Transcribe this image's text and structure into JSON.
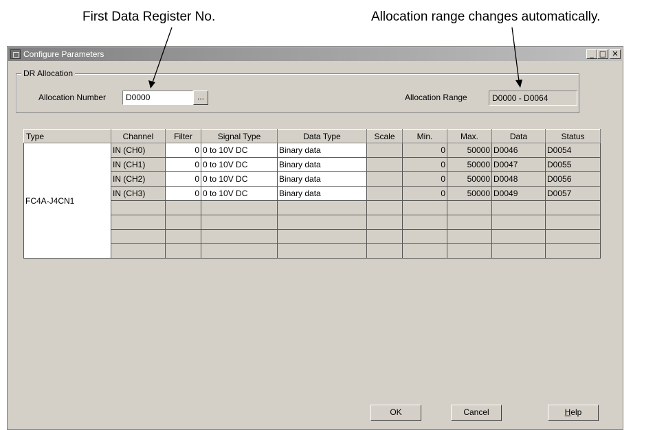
{
  "annotations": {
    "first_register": "First Data Register No.",
    "alloc_range_auto": "Allocation range changes automatically."
  },
  "window": {
    "title": "Configure Parameters",
    "minimize_glyph": "_",
    "maximize_glyph": "□",
    "close_glyph": "✕"
  },
  "dr_allocation": {
    "group_label": "DR Allocation",
    "number_label": "Allocation Number",
    "number_value": "D0000",
    "browse_label": "...",
    "range_label": "Allocation Range",
    "range_value": "D0000 - D0064"
  },
  "table": {
    "headers": [
      "Type",
      "Channel",
      "Filter",
      "Signal Type",
      "Data Type",
      "Scale",
      "Min.",
      "Max.",
      "Data",
      "Status"
    ],
    "type_value": "FC4A-J4CN1",
    "rows": [
      {
        "channel": "IN (CH0)",
        "filter": "0",
        "signal_type": "0 to 10V DC",
        "data_type": "Binary data",
        "scale": "",
        "min": "0",
        "max": "50000",
        "data": "D0046",
        "status": "D0054"
      },
      {
        "channel": "IN (CH1)",
        "filter": "0",
        "signal_type": "0 to 10V DC",
        "data_type": "Binary data",
        "scale": "",
        "min": "0",
        "max": "50000",
        "data": "D0047",
        "status": "D0055"
      },
      {
        "channel": "IN (CH2)",
        "filter": "0",
        "signal_type": "0 to 10V DC",
        "data_type": "Binary data",
        "scale": "",
        "min": "0",
        "max": "50000",
        "data": "D0048",
        "status": "D0056"
      },
      {
        "channel": "IN (CH3)",
        "filter": "0",
        "signal_type": "0 to 10V DC",
        "data_type": "Binary data",
        "scale": "",
        "min": "0",
        "max": "50000",
        "data": "D0049",
        "status": "D0057"
      },
      {
        "channel": "",
        "filter": "",
        "signal_type": "",
        "data_type": "",
        "scale": "",
        "min": "",
        "max": "",
        "data": "",
        "status": ""
      },
      {
        "channel": "",
        "filter": "",
        "signal_type": "",
        "data_type": "",
        "scale": "",
        "min": "",
        "max": "",
        "data": "",
        "status": ""
      },
      {
        "channel": "",
        "filter": "",
        "signal_type": "",
        "data_type": "",
        "scale": "",
        "min": "",
        "max": "",
        "data": "",
        "status": ""
      },
      {
        "channel": "",
        "filter": "",
        "signal_type": "",
        "data_type": "",
        "scale": "",
        "min": "",
        "max": "",
        "data": "",
        "status": ""
      }
    ]
  },
  "buttons": {
    "ok": "OK",
    "cancel": "Cancel",
    "help_first": "H",
    "help_rest": "elp"
  }
}
